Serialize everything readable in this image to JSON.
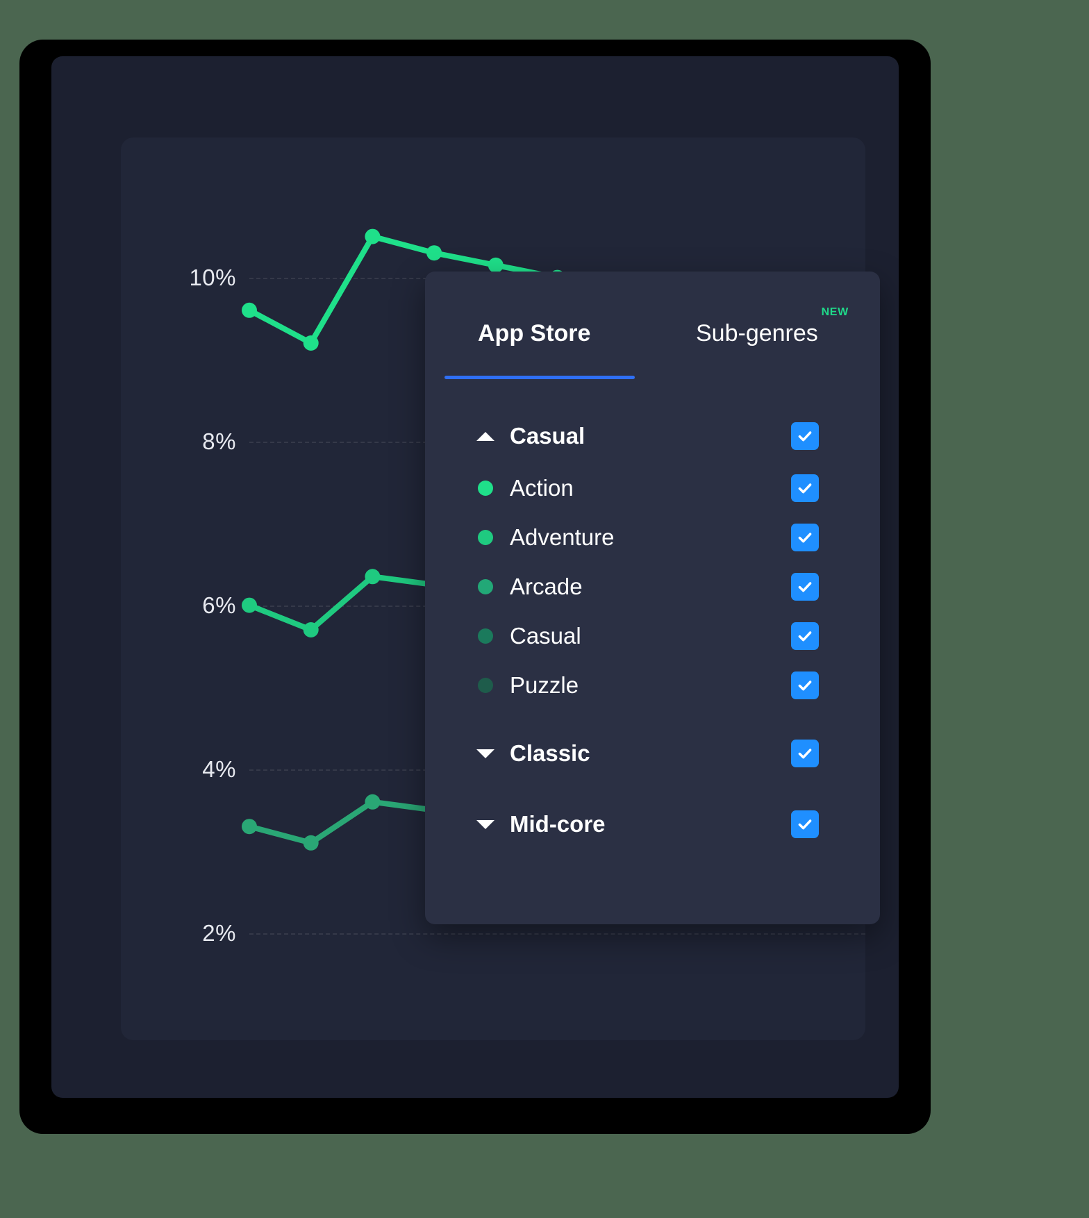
{
  "window": {
    "background_color": "#4b6650",
    "frame_color": "#000000",
    "body_color": "#1c2030",
    "card_color": "#212638"
  },
  "chart_data": {
    "type": "line",
    "title": "",
    "xlabel": "",
    "ylabel": "",
    "ylim": [
      1.2,
      11.2
    ],
    "grid": true,
    "gridlines_style": "dashed",
    "legend_position": "none",
    "tick_labels": [
      "10%",
      "8%",
      "6%",
      "4%",
      "2%"
    ],
    "tick_values": [
      10,
      8,
      6,
      4,
      2
    ],
    "series": [
      {
        "name": "Action",
        "color": "#1fe08a",
        "values": [
          9.6,
          9.2,
          10.5,
          10.3,
          10.15,
          10.0,
          9.7,
          9.5,
          9.35,
          9.2,
          9.1
        ]
      },
      {
        "name": "Adventure",
        "color": "#1fca80",
        "values": [
          6.0,
          5.7,
          6.35,
          6.25,
          6.15,
          6.05,
          6.0,
          5.95,
          5.9,
          5.85,
          5.8
        ]
      },
      {
        "name": "Arcade",
        "color": "#2aa775",
        "values": [
          3.3,
          3.1,
          3.6,
          3.5,
          3.4,
          3.3,
          3.25,
          3.2,
          3.18,
          3.15,
          3.1
        ]
      }
    ]
  },
  "dropdown": {
    "tabs": [
      {
        "label": "App Store",
        "active": true
      },
      {
        "label": "Sub-genres",
        "active": false,
        "badge": "NEW"
      }
    ],
    "items": [
      {
        "label": "Casual",
        "kind": "group",
        "caret": "up",
        "checked": true
      },
      {
        "label": "Action",
        "kind": "item",
        "dot": "#1fe08a",
        "checked": true
      },
      {
        "label": "Adventure",
        "kind": "item",
        "dot": "#1fca80",
        "checked": true
      },
      {
        "label": "Arcade",
        "kind": "item",
        "dot": "#22a877",
        "checked": true
      },
      {
        "label": "Casual",
        "kind": "item",
        "dot": "#1b7a5c",
        "checked": true
      },
      {
        "label": "Puzzle",
        "kind": "item",
        "dot": "#1e5c4b",
        "checked": true
      },
      {
        "label": "Classic",
        "kind": "group",
        "caret": "down",
        "checked": true
      },
      {
        "label": "Mid-core",
        "kind": "group",
        "caret": "down",
        "checked": true
      }
    ],
    "accent_color": "#1f8fff",
    "tab_underline_color": "#2f6ff5",
    "badge_color": "#1fd98a",
    "panel_color": "#2b3044"
  }
}
